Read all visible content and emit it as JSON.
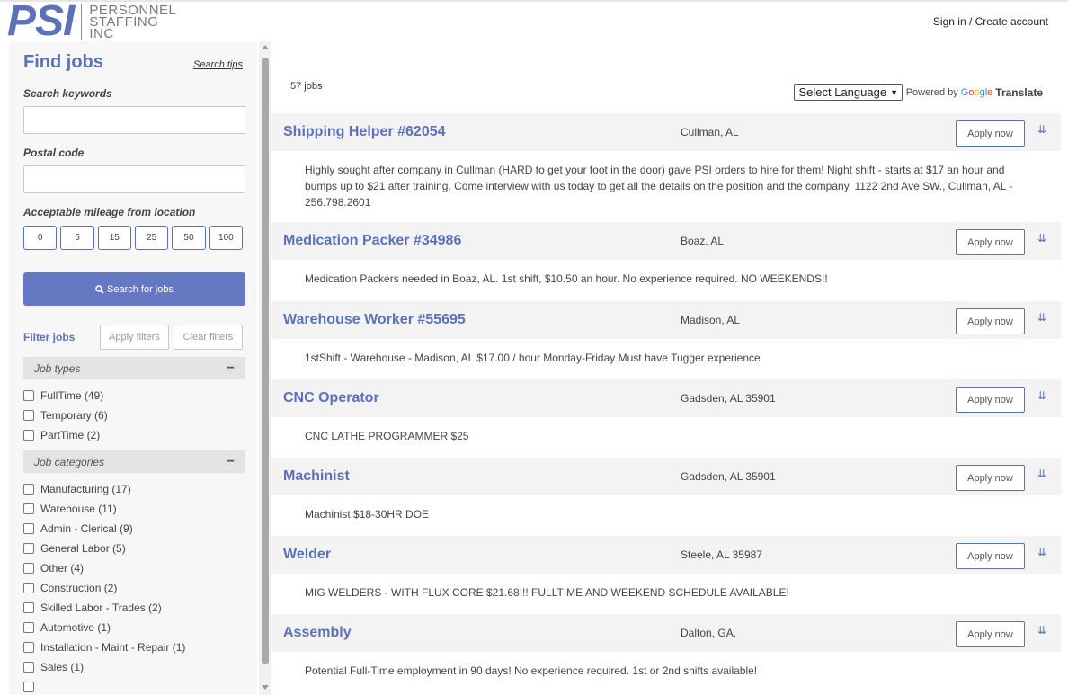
{
  "header": {
    "logo_mark": "PSI",
    "logo_line1": "PERSONNEL",
    "logo_line2": "STAFFING",
    "logo_line3": "INC",
    "signin": "Sign in / Create account"
  },
  "sidebar": {
    "title": "Find jobs",
    "search_tips": "Search tips",
    "keywords_label": "Search keywords",
    "keywords_value": "",
    "postal_label": "Postal code",
    "postal_value": "",
    "mileage_label": "Acceptable mileage from location",
    "mileage_options": [
      "0",
      "5",
      "15",
      "25",
      "50",
      "100"
    ],
    "search_button": "Search for jobs",
    "filter_label": "Filter jobs",
    "apply_filters": "Apply filters",
    "clear_filters": "Clear filters",
    "job_types_label": "Job types",
    "job_types": [
      "FullTime (49)",
      "Temporary (6)",
      "PartTime (2)"
    ],
    "job_categories_label": "Job categories",
    "job_categories": [
      "Manufacturing (17)",
      "Warehouse (11)",
      "Admin - Clerical (9)",
      "General Labor (5)",
      "Other (4)",
      "Construction (2)",
      "Skilled Labor - Trades (2)",
      "Automotive (1)",
      "Installation - Maint - Repair (1)",
      "Sales (1)"
    ]
  },
  "main": {
    "count": "57 jobs",
    "language_select": "Select Language",
    "powered_by": "Powered by",
    "google": "Google",
    "translate": "Translate",
    "apply_label": "Apply now",
    "jobs": [
      {
        "title": "Shipping Helper #62054",
        "location": "Cullman, AL",
        "description": "Highly sought after company in Cullman (HARD to get your foot in the door) gave PSI orders to hire for them! Night shift - starts at $17 an hour and bumps up to $21 after training. Come interview with us today to get all the details on the position and the company. 1122 2nd Ave SW., Cullman, AL - 256.798.2601"
      },
      {
        "title": "Medication Packer #34986",
        "location": "Boaz, AL",
        "description": "Medication Packers needed in Boaz, AL. 1st shift, $10.50 an hour. No experience required. NO WEEKENDS!!"
      },
      {
        "title": "Warehouse Worker #55695",
        "location": "Madison, AL",
        "description": "1stShift - Warehouse - Madison, AL $17.00 / hour Monday-Friday Must have Tugger experience"
      },
      {
        "title": "CNC Operator",
        "location": "Gadsden, AL 35901",
        "description": "CNC LATHE PROGRAMMER $25"
      },
      {
        "title": "Machinist",
        "location": "Gadsden, AL 35901",
        "description": "Machinist $18-30HR DOE"
      },
      {
        "title": "Welder",
        "location": "Steele, AL 35987",
        "description": "MIG WELDERS - WITH FLUX CORE $21.68!!! FULLTIME AND WEEKEND SCHEDULE AVAILABLE!"
      },
      {
        "title": "Assembly",
        "location": "Dalton, GA.",
        "description": "Potential Full-Time employment in 90 days! No experience required. 1st or 2nd shifts available!"
      }
    ]
  },
  "colors": {
    "brand": "#5b72b8",
    "button": "#6478c4"
  }
}
